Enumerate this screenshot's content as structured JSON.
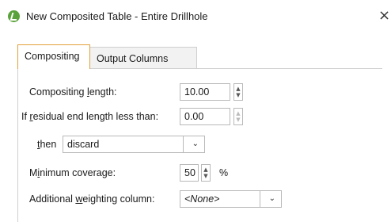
{
  "window": {
    "title": "New Composited Table - Entire Drillhole",
    "close_glyph": "×",
    "icon": "leapfrog-app-icon"
  },
  "tabs": [
    {
      "label": "Compositing",
      "active": true
    },
    {
      "label": "Output Columns",
      "active": false
    }
  ],
  "form": {
    "compositing_length": {
      "label_pre": "Compositing ",
      "label_u": "l",
      "label_post": "ength:",
      "value": "10.00"
    },
    "residual": {
      "label_pre": "If ",
      "label_u": "r",
      "label_post": "esidual end length less than:",
      "value": "0.00"
    },
    "then": {
      "label_u": "t",
      "label_post": "hen",
      "value": "discard"
    },
    "min_coverage": {
      "label_pre": "M",
      "label_u": "i",
      "label_post": "nimum coverage:",
      "value": "50",
      "unit": "%"
    },
    "weighting": {
      "label_pre": "Additional ",
      "label_u": "w",
      "label_post": "eighting column:",
      "value": "<None>"
    }
  },
  "colors": {
    "active_tab_border": "#e2a13a",
    "icon_green": "#5aa33c"
  }
}
